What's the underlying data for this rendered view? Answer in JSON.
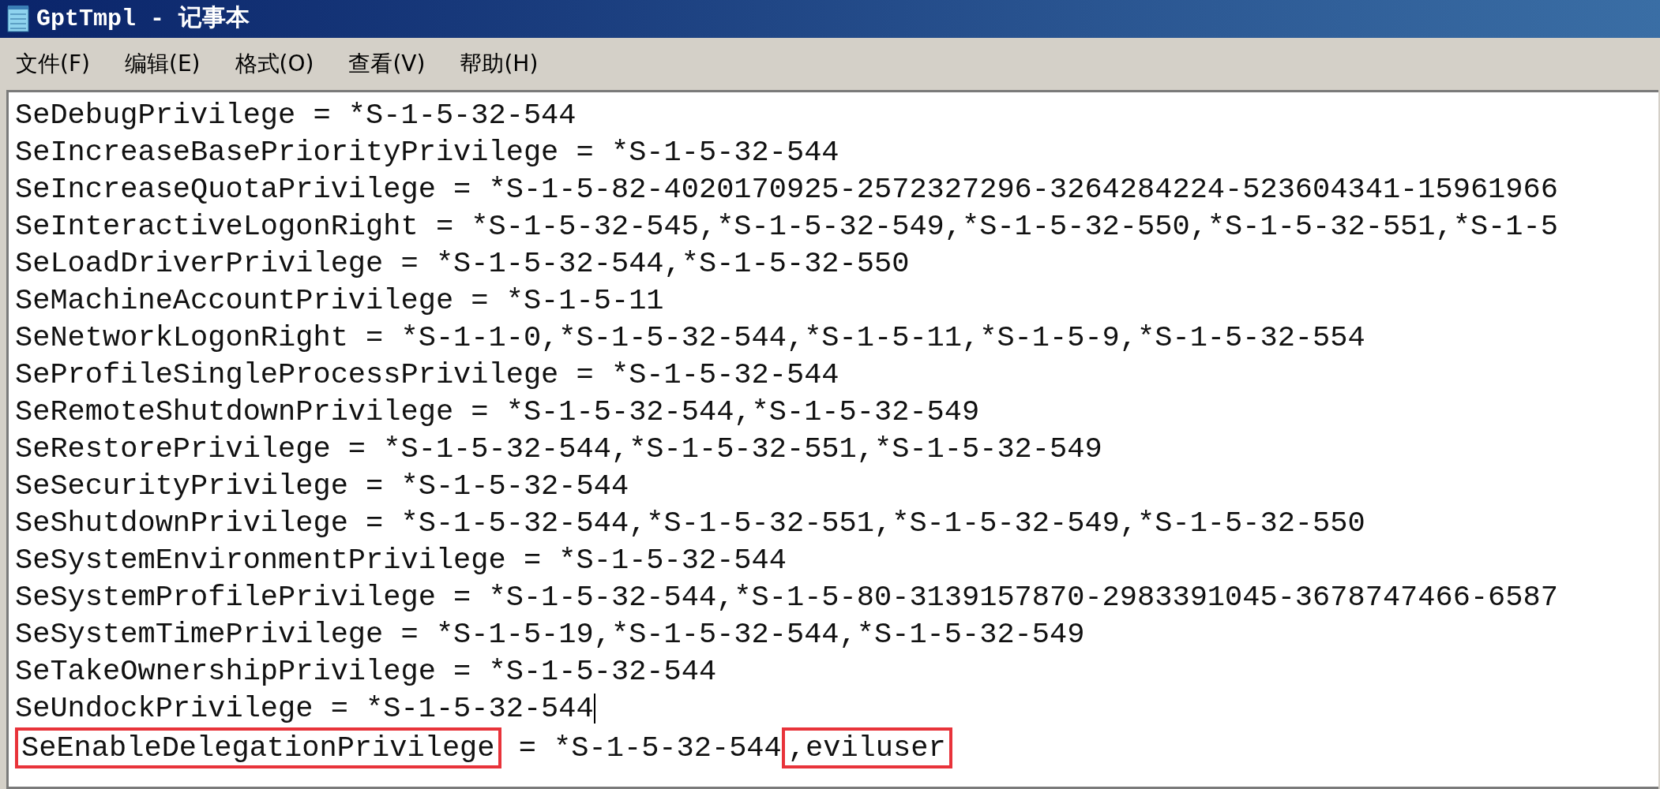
{
  "window": {
    "title": "GptTmpl - 记事本"
  },
  "menu": [
    "文件(F)",
    "编辑(E)",
    "格式(O)",
    "查看(V)",
    "帮助(H)"
  ],
  "lines": [
    {
      "segments": [
        {
          "text": "SeDebugPrivilege = *S-1-5-32-544",
          "highlighted": false
        }
      ],
      "caret": false
    },
    {
      "segments": [
        {
          "text": "SeIncreaseBasePriorityPrivilege = *S-1-5-32-544",
          "highlighted": false
        }
      ],
      "caret": false
    },
    {
      "segments": [
        {
          "text": "SeIncreaseQuotaPrivilege = *S-1-5-82-4020170925-2572327296-3264284224-523604341-15961966",
          "highlighted": false
        }
      ],
      "caret": false
    },
    {
      "segments": [
        {
          "text": "SeInteractiveLogonRight = *S-1-5-32-545,*S-1-5-32-549,*S-1-5-32-550,*S-1-5-32-551,*S-1-5",
          "highlighted": false
        }
      ],
      "caret": false
    },
    {
      "segments": [
        {
          "text": "SeLoadDriverPrivilege = *S-1-5-32-544,*S-1-5-32-550",
          "highlighted": false
        }
      ],
      "caret": false
    },
    {
      "segments": [
        {
          "text": "SeMachineAccountPrivilege = *S-1-5-11",
          "highlighted": false
        }
      ],
      "caret": false
    },
    {
      "segments": [
        {
          "text": "SeNetworkLogonRight = *S-1-1-0,*S-1-5-32-544,*S-1-5-11,*S-1-5-9,*S-1-5-32-554",
          "highlighted": false
        }
      ],
      "caret": false
    },
    {
      "segments": [
        {
          "text": "SeProfileSingleProcessPrivilege = *S-1-5-32-544",
          "highlighted": false
        }
      ],
      "caret": false
    },
    {
      "segments": [
        {
          "text": "SeRemoteShutdownPrivilege = *S-1-5-32-544,*S-1-5-32-549",
          "highlighted": false
        }
      ],
      "caret": false
    },
    {
      "segments": [
        {
          "text": "SeRestorePrivilege = *S-1-5-32-544,*S-1-5-32-551,*S-1-5-32-549",
          "highlighted": false
        }
      ],
      "caret": false
    },
    {
      "segments": [
        {
          "text": "SeSecurityPrivilege = *S-1-5-32-544",
          "highlighted": false
        }
      ],
      "caret": false
    },
    {
      "segments": [
        {
          "text": "SeShutdownPrivilege = *S-1-5-32-544,*S-1-5-32-551,*S-1-5-32-549,*S-1-5-32-550",
          "highlighted": false
        }
      ],
      "caret": false
    },
    {
      "segments": [
        {
          "text": "SeSystemEnvironmentPrivilege = *S-1-5-32-544",
          "highlighted": false
        }
      ],
      "caret": false
    },
    {
      "segments": [
        {
          "text": "SeSystemProfilePrivilege = *S-1-5-32-544,*S-1-5-80-3139157870-2983391045-3678747466-6587",
          "highlighted": false
        }
      ],
      "caret": false
    },
    {
      "segments": [
        {
          "text": "SeSystemTimePrivilege = *S-1-5-19,*S-1-5-32-544,*S-1-5-32-549",
          "highlighted": false
        }
      ],
      "caret": false
    },
    {
      "segments": [
        {
          "text": "SeTakeOwnershipPrivilege = *S-1-5-32-544",
          "highlighted": false
        }
      ],
      "caret": false
    },
    {
      "segments": [
        {
          "text": "SeUndockPrivilege = *S-1-5-32-544",
          "highlighted": false
        }
      ],
      "caret": true
    },
    {
      "segments": [
        {
          "text": "SeEnableDelegationPrivilege",
          "highlighted": true
        },
        {
          "text": " = *S-1-5-32-544",
          "highlighted": false
        },
        {
          "text": ",eviluser",
          "highlighted": true
        }
      ],
      "caret": false
    }
  ]
}
